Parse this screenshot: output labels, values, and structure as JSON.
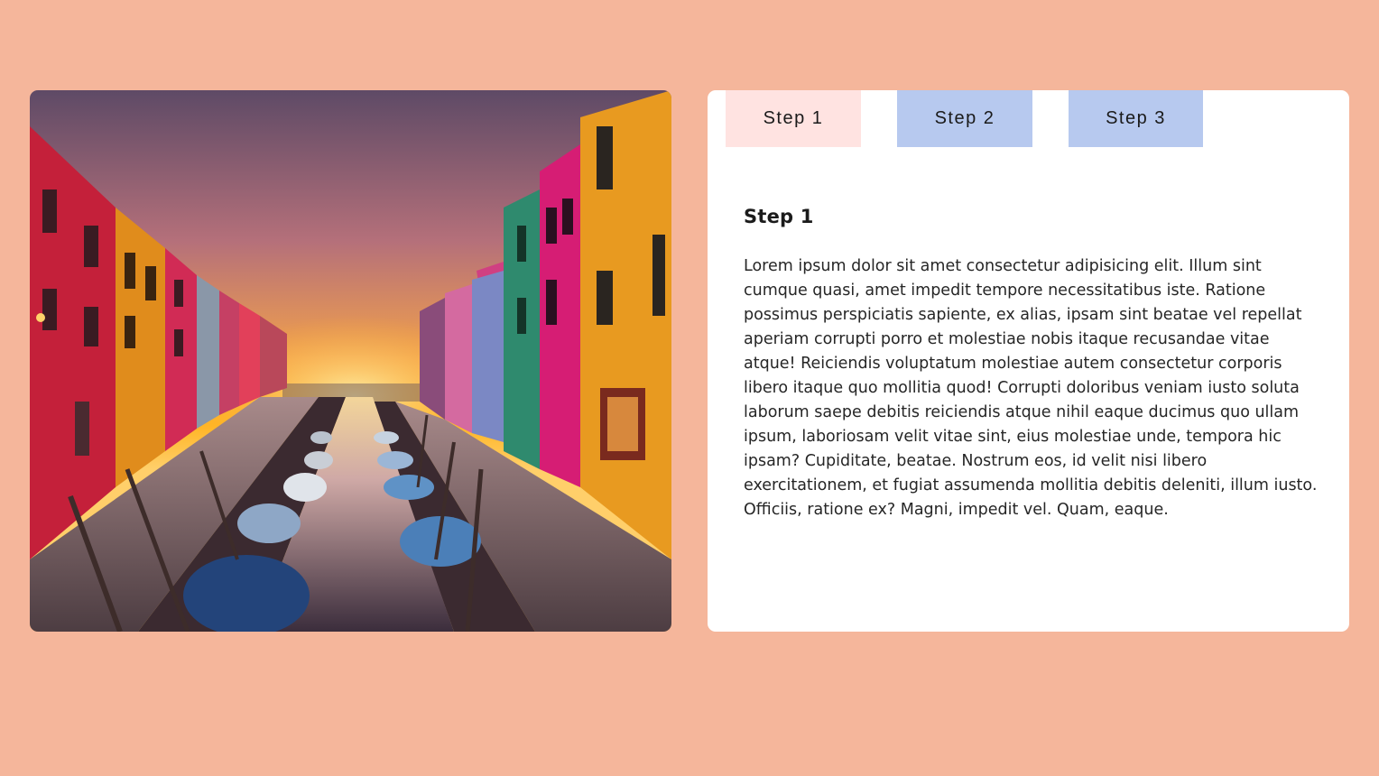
{
  "colors": {
    "page_background": "#f5b69b",
    "card_background": "#ffffff",
    "tab_active": "#ffe3e1",
    "tab_inactive": "#b7c9ef"
  },
  "photo": {
    "subject": "sunset over a canal lined with colorful houses and moored boats"
  },
  "tabs": [
    {
      "label": "Step 1",
      "active": true
    },
    {
      "label": "Step 2",
      "active": false
    },
    {
      "label": "Step 3",
      "active": false
    }
  ],
  "panel": {
    "title": "Step 1",
    "body": "Lorem ipsum dolor sit amet consectetur adipisicing elit. Illum sint cumque quasi, amet impedit tempore necessitatibus iste. Ratione possimus perspiciatis sapiente, ex alias, ipsam sint beatae vel repellat aperiam corrupti porro et molestiae nobis itaque recusandae vitae atque! Reiciendis voluptatum molestiae autem consectetur corporis libero itaque quo mollitia quod! Corrupti doloribus veniam iusto soluta laborum saepe debitis reiciendis atque nihil eaque ducimus quo ullam ipsum, laboriosam velit vitae sint, eius molestiae unde, tempora hic ipsam? Cupiditate, beatae. Nostrum eos, id velit nisi libero exercitationem, et fugiat assumenda mollitia debitis deleniti, illum iusto. Officiis, ratione ex? Magni, impedit vel. Quam, eaque."
  }
}
